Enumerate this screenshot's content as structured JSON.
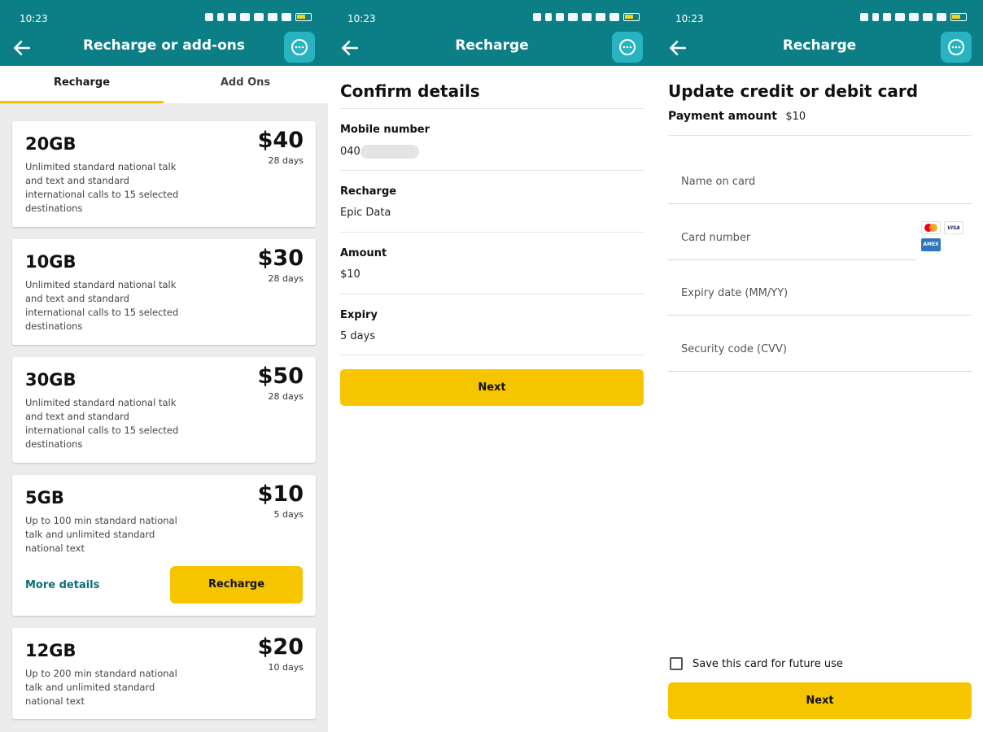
{
  "status_bar": {
    "time": "10:23"
  },
  "screen1": {
    "title": "Recharge or add-ons",
    "tabs": [
      "Recharge",
      "Add Ons"
    ],
    "plans": [
      {
        "data": "20GB",
        "price": "$40",
        "duration": "28 days",
        "description": "Unlimited standard national talk and text and standard international calls to 15 selected destinations"
      },
      {
        "data": "10GB",
        "price": "$30",
        "duration": "28 days",
        "description": "Unlimited standard national talk and text and standard international calls to 15 selected destinations"
      },
      {
        "data": "30GB",
        "price": "$50",
        "duration": "28 days",
        "description": "Unlimited standard national talk and text and standard international calls to 15 selected destinations"
      },
      {
        "data": "5GB",
        "price": "$10",
        "duration": "5 days",
        "description": "Up to 100 min standard national talk and unlimited standard national text",
        "more_details_label": "More details",
        "recharge_label": "Recharge"
      },
      {
        "data": "12GB",
        "price": "$20",
        "duration": "10 days",
        "description": "Up to 200 min standard national talk and unlimited standard national text"
      }
    ]
  },
  "screen2": {
    "title": "Recharge",
    "heading": "Confirm details",
    "rows": [
      {
        "label": "Mobile number",
        "value": "040"
      },
      {
        "label": "Recharge",
        "value": "Epic Data"
      },
      {
        "label": "Amount",
        "value": "$10"
      },
      {
        "label": "Expiry",
        "value": "5 days"
      }
    ],
    "next_label": "Next"
  },
  "screen3": {
    "title": "Recharge",
    "heading": "Update credit or debit card",
    "payment_amount_label": "Payment amount",
    "payment_amount_value": "$10",
    "fields": [
      {
        "placeholder": "Name on card"
      },
      {
        "placeholder": "Card number"
      },
      {
        "placeholder": "Expiry date (MM/YY)"
      },
      {
        "placeholder": "Security code (CVV)"
      }
    ],
    "card_logos": [
      "mastercard-icon",
      "visa-icon",
      "amex-icon"
    ],
    "logo_text": {
      "visa": "VISA",
      "amex": "AMEX"
    },
    "save_card_label": "Save this card for future use",
    "next_label": "Next"
  },
  "colors": {
    "app_bar": "#0c7f86",
    "chat_button": "#27b3c0",
    "accent_yellow": "#f7c500",
    "link": "#0c6f76"
  }
}
